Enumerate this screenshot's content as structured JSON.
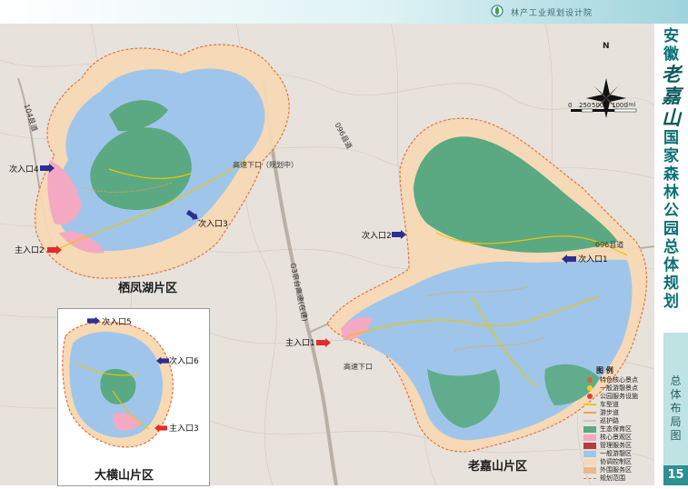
{
  "header": {
    "org": "林产工业规划设计院"
  },
  "title": {
    "chars": [
      "安",
      "徽",
      "老",
      "嘉",
      "山",
      "国",
      "家",
      "森",
      "林",
      "公",
      "园",
      "总",
      "体",
      "规",
      "划"
    ]
  },
  "subtitle": {
    "chars": [
      "总",
      "体",
      "布",
      "局",
      "图"
    ]
  },
  "page_number": "15",
  "compass": {
    "label": "N"
  },
  "scale": {
    "ticks": [
      "0",
      "250",
      "500",
      "1000"
    ],
    "unit": "(m)"
  },
  "regions": {
    "qifenghu": "栖凤湖片区",
    "laojiashan": "老嘉山片区",
    "dahengshan": "大横山片区"
  },
  "entrances": {
    "main2": "主入口2",
    "sec4": "次入口4",
    "sec3": "次入口3",
    "main1": "主入口1",
    "sec2": "次入口2",
    "sec1": "次入口1",
    "sec5": "次入口5",
    "sec6": "次入口6",
    "main3": "主入口3"
  },
  "roads": {
    "expressway_exit_planned": "高速下口（规划中）",
    "expressway_exit": "高速下口",
    "county_road_096a": "096县道",
    "county_road_096b": "096县道",
    "county_road_104": "104县道",
    "g3": "G3京台高速(在建)"
  },
  "legend": {
    "title": "图  例",
    "items": [
      {
        "label": "特色核心景点",
        "kind": "dot",
        "color": "#e0602a"
      },
      {
        "label": "一般游憩景点",
        "kind": "dot",
        "color": "#f2d21e"
      },
      {
        "label": "公园服务设施",
        "kind": "dot",
        "color": "#e73a3a"
      },
      {
        "label": "车型道",
        "kind": "line",
        "color": "#f0c400"
      },
      {
        "label": "游步道",
        "kind": "line",
        "color": "#f2a13a"
      },
      {
        "label": "巡护路",
        "kind": "line",
        "color": "#c9c9c9"
      },
      {
        "label": "生态保育区",
        "kind": "fill",
        "color": "#5aa982"
      },
      {
        "label": "核心景观区",
        "kind": "fill",
        "color": "#f3a9c1"
      },
      {
        "label": "管理服务区",
        "kind": "fill",
        "color": "#b23f3f"
      },
      {
        "label": "一般游憩区",
        "kind": "fill",
        "color": "#9fc6ea"
      },
      {
        "label": "协调控制区",
        "kind": "fill",
        "color": "#f7d9b4"
      },
      {
        "label": "外围服务区",
        "kind": "fill",
        "color": "#e7b98d"
      },
      {
        "label": "规划范围",
        "kind": "dash",
        "color": "#e66d3a"
      }
    ]
  },
  "colors": {
    "conservation": "#5aa982",
    "recreation": "#9fc6ea",
    "core": "#f3a9c1",
    "buffer": "#f7d9b4",
    "boundary": "#e66d3a",
    "road": "#f0c400",
    "entrance_main": "#e02d2d",
    "entrance_secondary": "#2d2f8f"
  }
}
